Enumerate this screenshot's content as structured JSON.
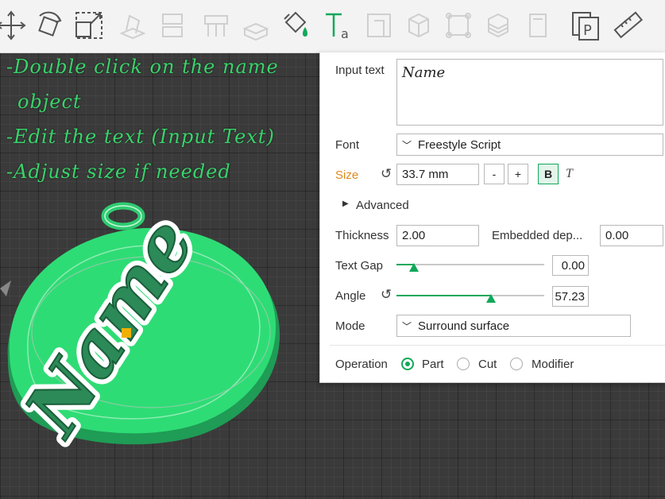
{
  "annotations": [
    "-Double click on the name",
    "object",
    "-Edit the text (Input Text)",
    "-Adjust size if needed"
  ],
  "toolbar": {
    "icons": [
      "move-icon",
      "rotate-icon",
      "scale-icon",
      "lay-on-face-icon",
      "cut-icon",
      "support-icon",
      "seam-icon",
      "paint-icon",
      "text-icon",
      "measure-box-icon",
      "cube-icon",
      "assembly-icon",
      "variable-layer-icon",
      "fdm-icon",
      "plate-icon",
      "ruler-icon"
    ]
  },
  "panel": {
    "input_text_label": "Input text",
    "input_text_value": "Name",
    "font_label": "Font",
    "font_value": "Freestyle Script",
    "size_label": "Size",
    "size_value": "33.7 mm",
    "minus": "-",
    "plus": "+",
    "bold": "B",
    "italic": "T",
    "advanced_label": "Advanced",
    "thickness_label": "Thickness",
    "thickness_value": "2.00",
    "embedded_label": "Embedded dep...",
    "embedded_value": "0.00",
    "text_gap_label": "Text Gap",
    "text_gap_value": "0.00",
    "text_gap_level": 0.12,
    "angle_label": "Angle",
    "angle_value": "57.23",
    "angle_level": 0.64,
    "mode_label": "Mode",
    "mode_value": "Surround surface",
    "operation_label": "Operation",
    "op_part": "Part",
    "op_cut": "Cut",
    "op_modifier": "Modifier",
    "selected_operation": "Part"
  },
  "model": {
    "text": "Name",
    "accent": "#2ecc71",
    "dark": "#1e9e55"
  },
  "colors": {
    "accent": "#12a85a",
    "size_label": "#e08a1e",
    "annotation": "#39d36a"
  }
}
